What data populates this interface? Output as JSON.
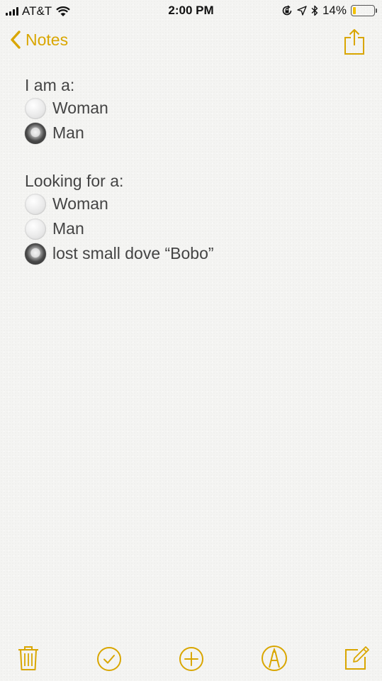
{
  "status_bar": {
    "carrier": "AT&T",
    "time": "2:00 PM",
    "battery_percent": "14%",
    "battery_level": 0.14,
    "icons": [
      "signal-icon",
      "wifi-icon",
      "orientation-lock-icon",
      "location-icon",
      "bluetooth-icon",
      "battery-icon"
    ]
  },
  "nav": {
    "back_label": "Notes",
    "share_icon": "share-icon"
  },
  "note": {
    "section1": {
      "title": "I am a:",
      "options": [
        {
          "label": "Woman",
          "selected": false
        },
        {
          "label": "Man",
          "selected": true
        }
      ]
    },
    "section2": {
      "title": "Looking for a:",
      "options": [
        {
          "label": "Woman",
          "selected": false
        },
        {
          "label": "Man",
          "selected": false
        },
        {
          "label": "lost small dove “Bobo”",
          "selected": true
        }
      ]
    }
  },
  "toolbar": {
    "icons": [
      "trash-icon",
      "checklist-icon",
      "add-icon",
      "markup-icon",
      "compose-icon"
    ]
  },
  "colors": {
    "accent": "#d9a600",
    "text": "#444444",
    "background": "#f4f4f2"
  }
}
